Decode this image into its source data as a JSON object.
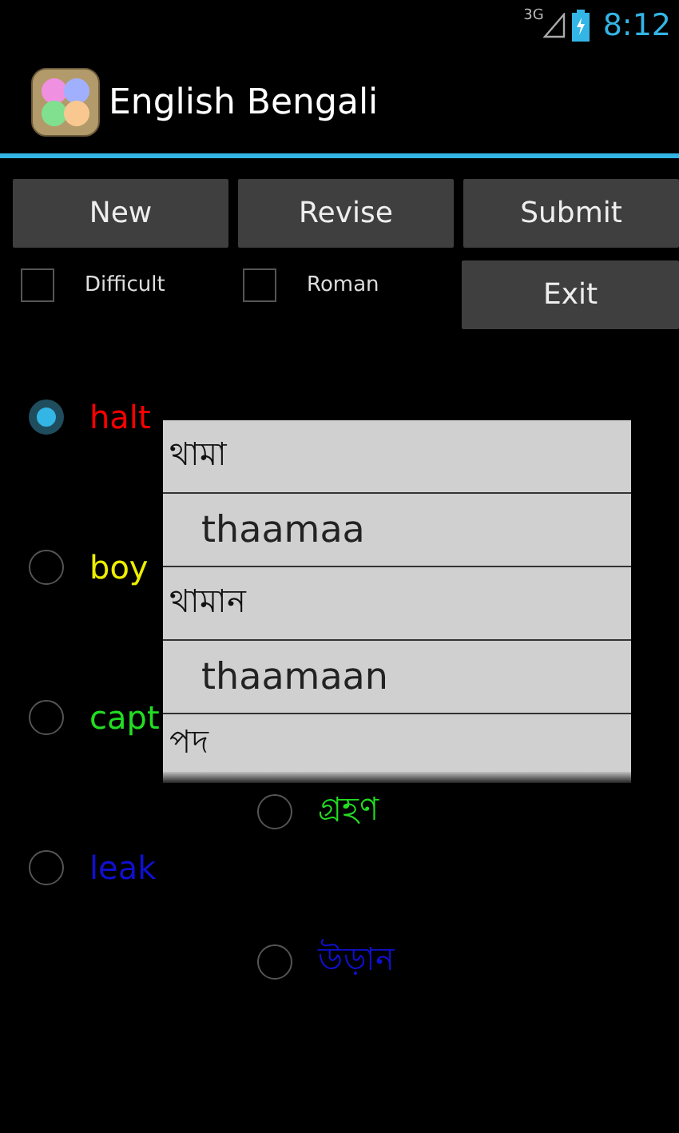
{
  "status_bar": {
    "network": "3G",
    "time": "8:12"
  },
  "app_bar": {
    "title": "English Bengali"
  },
  "buttons": [
    "New",
    "Revise",
    "Submit"
  ],
  "options": [
    {
      "label": "Difficult",
      "checked": false
    },
    {
      "label": "Roman",
      "checked": false
    }
  ],
  "exit_button": "Exit",
  "words": [
    {
      "label": "halt",
      "color": "#ff0000",
      "selected": true
    },
    {
      "label": "boy",
      "color": "#eeee00",
      "selected": false
    },
    {
      "label": "capt",
      "color": "#22dd22",
      "selected": false
    },
    {
      "label": "leak",
      "color": "#1010d0",
      "selected": false
    }
  ],
  "answers": [
    {
      "label": "গ্রহণ",
      "color": "#22dd22",
      "selected": false
    },
    {
      "label": "উড়ান",
      "color": "#1010d0",
      "selected": false
    }
  ],
  "dropdown": {
    "items": [
      {
        "kind": "bengali",
        "text": "থামা"
      },
      {
        "kind": "roman",
        "text": "thaamaa"
      },
      {
        "kind": "bengali",
        "text": "থামান"
      },
      {
        "kind": "roman",
        "text": "thaamaan"
      },
      {
        "kind": "bengali",
        "text": "পদ"
      }
    ]
  }
}
